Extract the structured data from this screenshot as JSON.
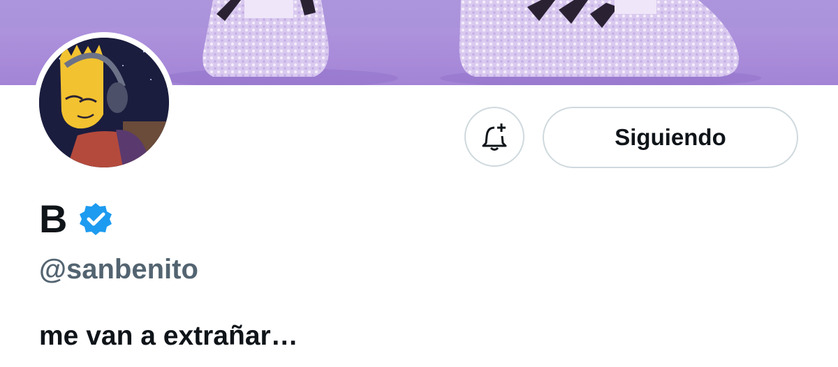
{
  "profile": {
    "display_name": "B",
    "handle": "@sanbenito",
    "bio": "me van a extrañar…",
    "verified": true
  },
  "actions": {
    "follow_label": "Siguiendo",
    "notifications_icon": "bell-plus-icon"
  },
  "icons": {
    "verified": "verified-badge-icon",
    "avatar": "avatar-image",
    "banner": "banner-image"
  },
  "colors": {
    "banner_purple": "#a887d8",
    "verified_blue": "#1d9bf0",
    "text_primary": "#0f1419",
    "text_secondary": "#536471",
    "border": "#cfd9de"
  }
}
